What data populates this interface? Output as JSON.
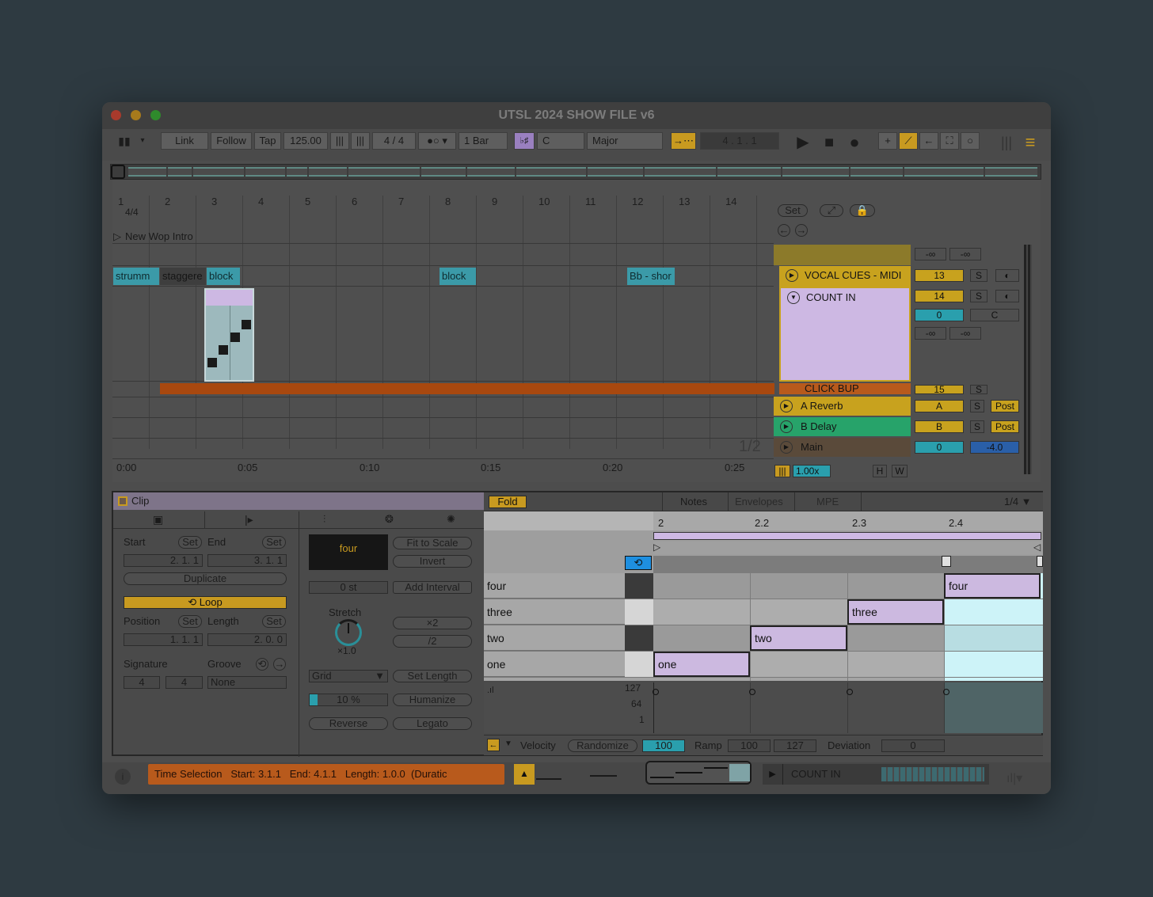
{
  "window": {
    "title": "UTSL 2024 SHOW FILE v6"
  },
  "toolbar": {
    "link": "Link",
    "follow": "Follow",
    "tap": "Tap",
    "tempo": "125.00",
    "time_sig": "4 / 4",
    "quantize": "1 Bar",
    "scale_icon": "♭♯",
    "key": "C",
    "scale": "Major",
    "position": "4 .   1 .   1"
  },
  "ruler": {
    "bars": [
      "1",
      "2",
      "3",
      "4",
      "5",
      "6",
      "7",
      "8",
      "9",
      "10",
      "11",
      "12",
      "13",
      "14"
    ],
    "time_sig_marker": "4/4",
    "locator": "New Wop Intro",
    "times": [
      "0:00",
      "0:05",
      "0:10",
      "0:15",
      "0:20",
      "0:25"
    ]
  },
  "arrangement": {
    "clips": [
      "strumm",
      "staggere",
      "block",
      "block",
      "Bb - shor"
    ],
    "set_label": "Set",
    "page_indicator": "1/2",
    "zoom": "1.00x",
    "h_btn": "H",
    "w_btn": "W"
  },
  "mixer": {
    "master_vol_left": "-∞",
    "master_vol_right": "-∞",
    "tracks": [
      {
        "name": "VOCAL CUES - MIDI",
        "number": "13",
        "solo": "S",
        "color": "#c8a21e"
      },
      {
        "name": "COUNT IN",
        "number": "14",
        "solo": "S",
        "color": "#cdb8e3",
        "vol": "0",
        "pan": "C",
        "meter_left": "-∞",
        "meter_right": "-∞"
      },
      {
        "name": "CLICK BUP",
        "number": "15",
        "solo": "S",
        "color": "#b85a1c"
      },
      {
        "name": "A Reverb",
        "number": "A",
        "solo": "S",
        "post": "Post",
        "color": "#c8a21e"
      },
      {
        "name": "B Delay",
        "number": "B",
        "solo": "S",
        "post": "Post",
        "color": "#27a36a"
      },
      {
        "name": "Main",
        "number": "0",
        "pan": "-4.0",
        "color": "#5a4a3a"
      }
    ]
  },
  "clip_panel": {
    "title": "Clip",
    "start_label": "Start",
    "end_label": "End",
    "set": "Set",
    "start_value": "2.   1.   1",
    "end_value": "3.   1.   1",
    "duplicate": "Duplicate",
    "loop": "Loop",
    "position_label": "Position",
    "length_label": "Length",
    "position_value": "1.   1.   1",
    "length_value": "2.   0.   0",
    "signature_label": "Signature",
    "groove_label": "Groove",
    "sig_num": "4",
    "sig_den": "4",
    "groove_value": "None"
  },
  "notes_panel": {
    "clip_name": "four",
    "fit_to_scale": "Fit to Scale",
    "invert": "Invert",
    "transpose": "0 st",
    "add_interval": "Add Interval",
    "stretch_label": "Stretch",
    "stretch_value": "×1.0",
    "double": "×2",
    "half": "/2",
    "grid": "Grid",
    "set_length": "Set Length",
    "humanize_amount": "10 %",
    "humanize": "Humanize",
    "reverse": "Reverse",
    "legato": "Legato"
  },
  "editor": {
    "fold": "Fold",
    "tabs": [
      "Notes",
      "Envelopes",
      "MPE"
    ],
    "grid_value": "1/4 ▼",
    "beats": [
      "2",
      "2.2",
      "2.3",
      "2.4"
    ],
    "keys": [
      "four",
      "three",
      "two",
      "one"
    ],
    "notes": [
      "one",
      "two",
      "three",
      "four"
    ],
    "vel_ticks": [
      "127",
      "64",
      "1"
    ],
    "velocity_label": "Velocity",
    "randomize": "Randomize",
    "velocity_value": "100",
    "ramp_label": "Ramp",
    "ramp_start": "100",
    "ramp_end": "127",
    "deviation_label": "Deviation",
    "deviation_value": "0"
  },
  "status": {
    "message": "Time Selection   Start: 3.1.1   End: 4.1.1   Length: 1.0.0  (Duratic",
    "track_name": "COUNT IN"
  }
}
